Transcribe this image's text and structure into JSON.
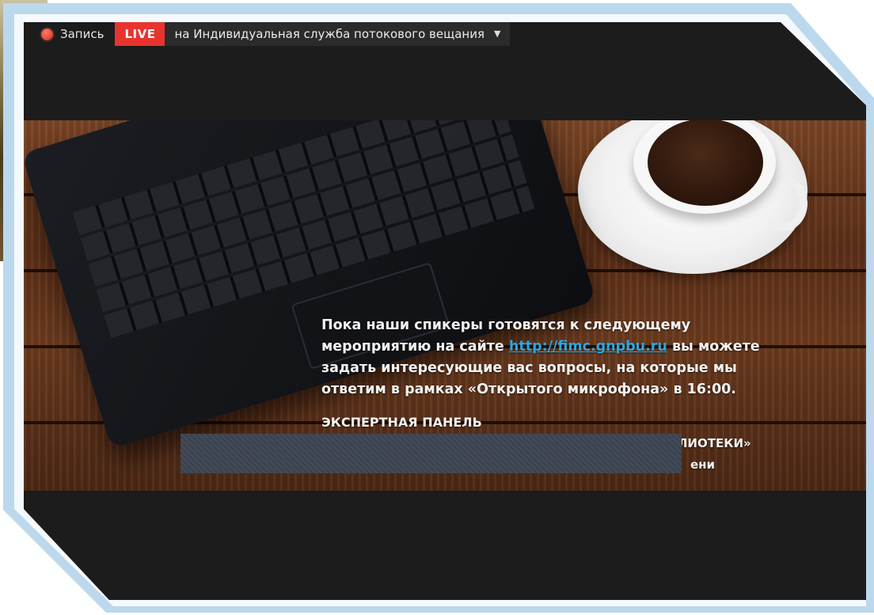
{
  "topbar": {
    "record_label": "Запись",
    "live_label": "LIVE",
    "stream_label": "на Индивидуальная служба потокового вещания"
  },
  "slide": {
    "line1": "Пока наши спикеры готовятся к следующему",
    "line2_prefix": "мероприятию на сайте",
    "link_text": "http://fimc.gnpbu.ru",
    "line2_suffix": "вы можете",
    "line3": "задать интересующие вас вопросы, на которые мы",
    "line4": "ответим в рамках «Открытого микрофона» в 16:00.",
    "panel_title": "ЭКСПЕРТНАЯ ПАНЕЛЬ",
    "panel_line1_visible": "ОЙ БИБЛИОТЕКИ»",
    "panel_line2_visible": "ени"
  },
  "colors": {
    "live_bg": "#e8342e",
    "link": "#2aa7e6",
    "frame": "#bcd8ec",
    "screen_bg": "#1c1c1c"
  },
  "icons": [
    "record-dot-icon",
    "dropdown-caret-icon"
  ]
}
